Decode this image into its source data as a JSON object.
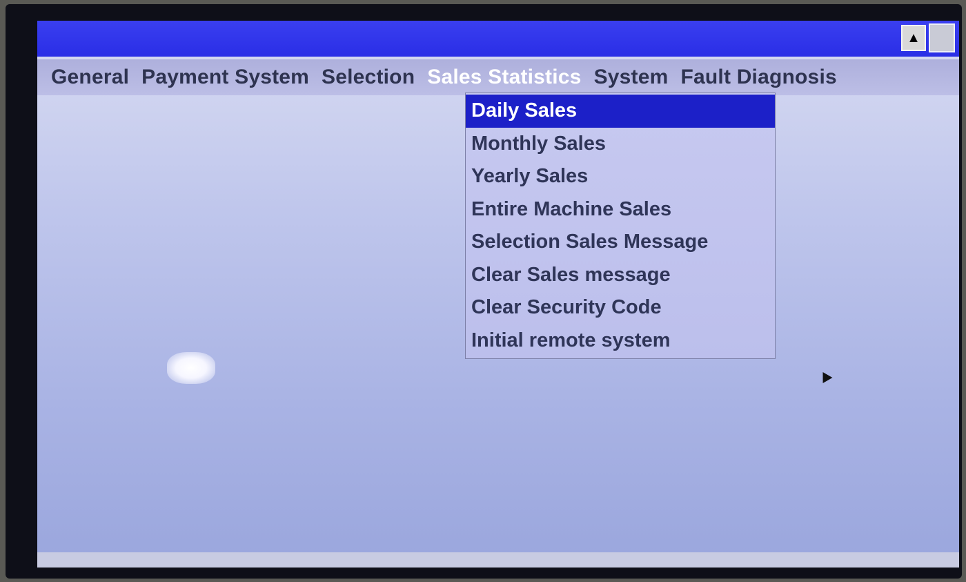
{
  "title_bar": {
    "scroll_up_icon": "▲",
    "color": "#2a2ee6"
  },
  "menu_bar": {
    "items": [
      {
        "label": "General"
      },
      {
        "label": "Payment System"
      },
      {
        "label": "Selection"
      },
      {
        "label": "Sales Statistics",
        "active": true
      },
      {
        "label": "System"
      },
      {
        "label": "Fault Diagnosis"
      }
    ]
  },
  "dropdown": {
    "selected_index": 0,
    "highlight_color": "#1c20c8",
    "items": [
      {
        "label": "Daily Sales"
      },
      {
        "label": "Monthly Sales"
      },
      {
        "label": "Yearly Sales"
      },
      {
        "label": "Entire Machine Sales"
      },
      {
        "label": "Selection Sales Message"
      },
      {
        "label": "Clear Sales message"
      },
      {
        "label": "Clear Security Code"
      },
      {
        "label": "Initial remote system"
      }
    ]
  }
}
